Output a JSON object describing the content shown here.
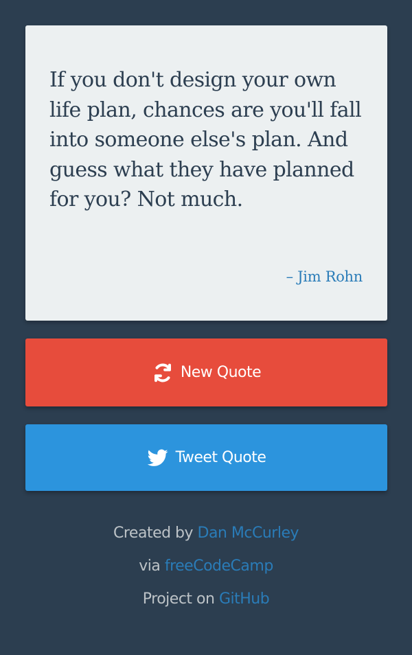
{
  "quote": {
    "text": "If you don't design your own life plan, chances are you'll fall into someone else's plan. And guess what they have planned for you? Not much.",
    "author": "– Jim Rohn"
  },
  "buttons": {
    "new_quote": {
      "label": "New Quote",
      "icon": "refresh-icon"
    },
    "tweet_quote": {
      "label": "Tweet Quote",
      "icon": "twitter-icon"
    }
  },
  "footer": {
    "created_prefix": "Created by",
    "created_link": "Dan McCurley",
    "via_prefix": "via",
    "via_link": "freeCodeCamp",
    "project_prefix": "Project on",
    "project_link": "GitHub"
  },
  "colors": {
    "background": "#2c3e50",
    "card": "#ecf0f1",
    "new_quote": "#e74c3c",
    "tweet_quote": "#2c94dd",
    "link": "#2a7cb8",
    "footer_text": "#bdc3c7"
  }
}
